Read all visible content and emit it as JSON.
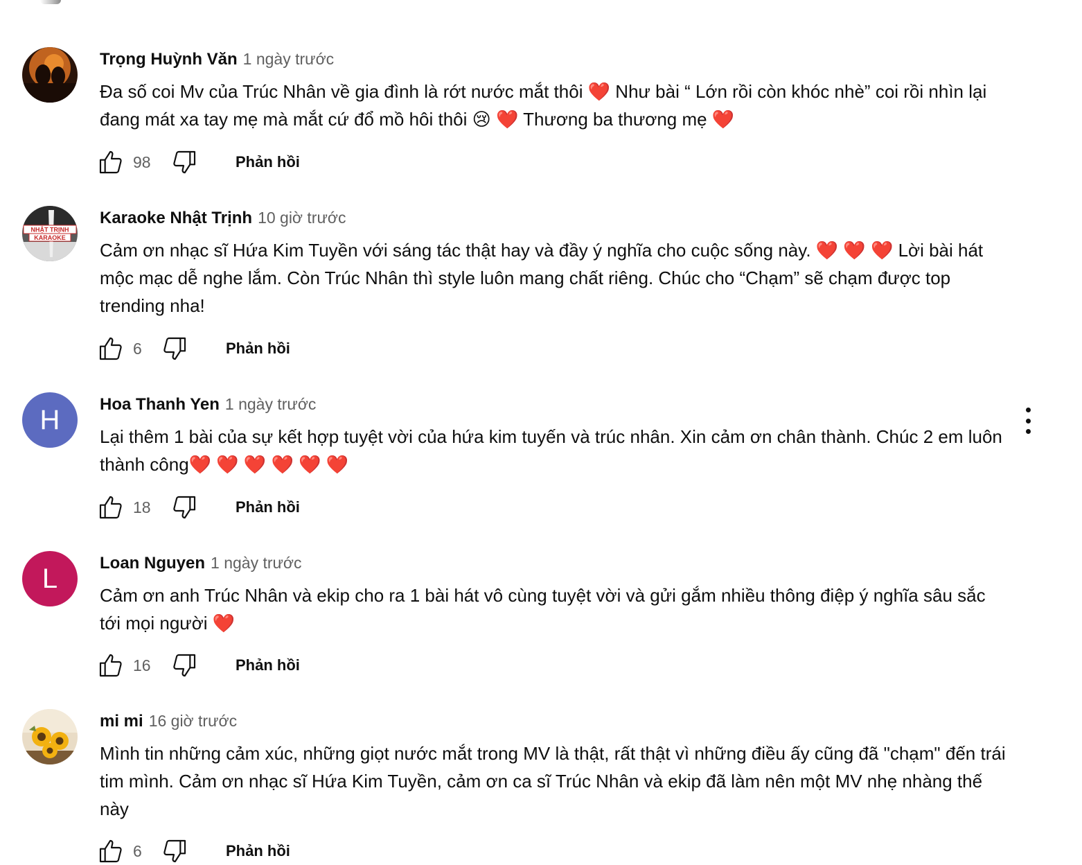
{
  "comments": [
    {
      "author": "Trọng Huỳnh Văn",
      "time": "1 ngày trước",
      "text": "Đa số coi Mv của Trúc Nhân về gia đình là rớt nước mắt thôi ❤️  Như bài “ Lớn rồi còn khóc nhè” coi rồi nhìn lại đang mát xa tay mẹ mà mắt cứ đổ mồ hôi thôi 😢 ❤️  Thương ba thương mẹ  ❤️",
      "likes": "98",
      "reply_label": "Phản hồi",
      "avatar": "photo-silhouettes-sunset"
    },
    {
      "author": "Karaoke Nhật Trịnh",
      "time": "10 giờ trước",
      "text": "Cảm ơn nhạc sĩ Hứa Kim Tuyền với sáng tác thật hay và đầy ý nghĩa cho cuộc sống này.  ❤️ ❤️ ❤️  Lời bài hát mộc mạc dễ nghe lắm. Còn Trúc Nhân thì style luôn mang chất riêng. Chúc cho “Chạm” sẽ chạm được top trending nha!",
      "likes": "6",
      "reply_label": "Phản hồi",
      "avatar": "logo-karaoke",
      "avatar_logo_lines": [
        "NHẬT TRỊNH",
        "KARAOKE"
      ]
    },
    {
      "author": "Hoa Thanh Yen",
      "time": "1 ngày trước",
      "text": "Lại thêm 1 bài của sự kết hợp tuyệt vời của hứa kim tuyến và trúc nhân. Xin cảm ơn chân thành. Chúc 2 em luôn thành công❤️ ❤️ ❤️ ❤️ ❤️ ❤️",
      "likes": "18",
      "reply_label": "Phản hồi",
      "avatar": "letter",
      "avatar_letter": "H",
      "avatar_color": "#5c6bc0"
    },
    {
      "author": "Loan Nguyen",
      "time": "1 ngày trước",
      "text": "Cảm ơn anh Trúc Nhân và ekip cho ra 1 bài hát vô cùng tuyệt vời và gửi gắm  nhiều thông điệp ý nghĩa sâu sắc tới mọi người  ❤️",
      "likes": "16",
      "reply_label": "Phản hồi",
      "avatar": "letter",
      "avatar_letter": "L",
      "avatar_color": "#c2185b"
    },
    {
      "author": "mi mi",
      "time": "16 giờ trước",
      "text": "Mình tin những cảm xúc, những giọt nước mắt trong MV là thật, rất thật vì những điều ấy cũng đã \"chạm\" đến trái tim mình. Cảm ơn nhạc sĩ Hứa Kim Tuyền, cảm ơn ca sĩ Trúc Nhân và ekip đã làm nên một MV nhẹ nhàng thế này",
      "likes": "6",
      "reply_label": "Phản hồi",
      "avatar": "photo-sunflowers"
    }
  ],
  "icons": {
    "like": "thumbs-up-outline-icon",
    "dislike": "thumbs-down-outline-icon",
    "menu": "more-vertical-icon"
  },
  "colors": {
    "text": "#0f0f0f",
    "secondary": "#606060"
  }
}
